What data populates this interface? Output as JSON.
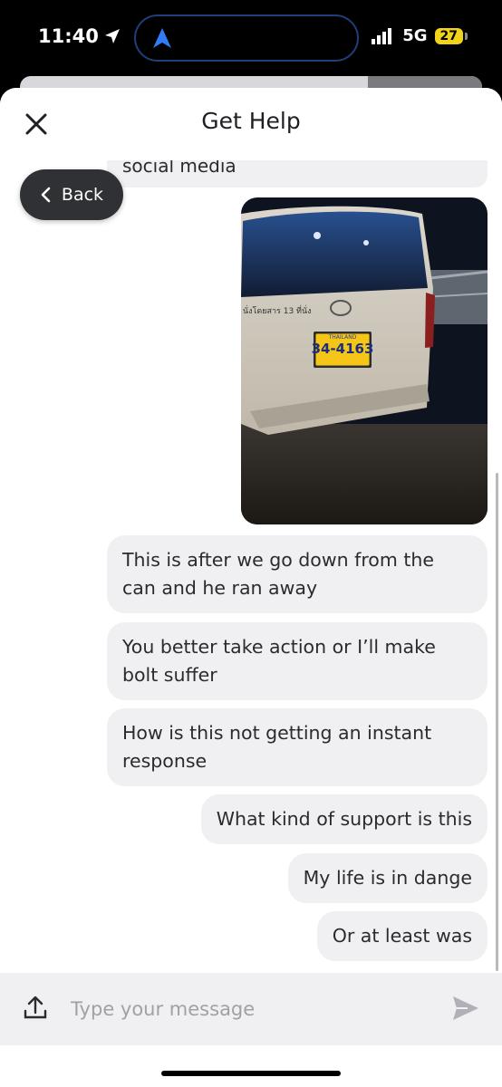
{
  "status_bar": {
    "time": "11:40",
    "network": "5G",
    "battery": "27"
  },
  "header": {
    "title": "Get Help"
  },
  "back_button": {
    "label": "Back"
  },
  "previous_message_tail": "social media",
  "photo": {
    "plate_country": "THAILAND",
    "plate_number": "34-4163",
    "rear_text": "นั่งโดยสาร 13 ที่นั่ง"
  },
  "messages": [
    {
      "text": "This is after we go down from the can and he ran away"
    },
    {
      "text": "You better take action or I’ll make bolt suffer"
    },
    {
      "text": "How is this not getting an instant response"
    },
    {
      "text": "What kind of support is this"
    },
    {
      "text": "My life is in dange"
    },
    {
      "text": "Or at least was"
    }
  ],
  "composer": {
    "placeholder": "Type your message"
  },
  "colors": {
    "bubble": "#f0f0f2",
    "back_button": "#2f3135",
    "text": "#2a2b2f"
  }
}
